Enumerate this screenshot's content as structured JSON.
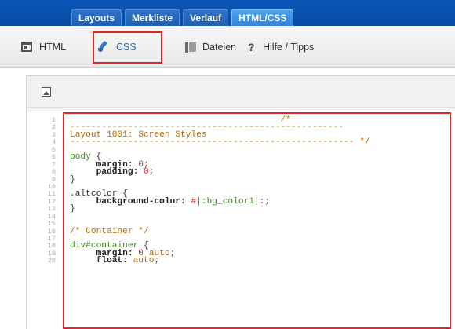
{
  "tabs": [
    {
      "label": "Layouts",
      "active": false
    },
    {
      "label": "Merkliste",
      "active": false
    },
    {
      "label": "Verlauf",
      "active": false
    },
    {
      "label": "HTML/CSS",
      "active": true
    }
  ],
  "toolbar": {
    "html_label": "HTML",
    "css_label": "CSS",
    "files_label": "Dateien",
    "help_label": "Hilfe / Tipps",
    "help_glyph": "?"
  },
  "colors": {
    "tabbar": "#0c56b8",
    "highlight_frame": "#e0262a",
    "comment": "#b26a00",
    "selector": "#3a8a1a",
    "value": "#d6302f"
  },
  "icons": {
    "html": "html-layout-icon",
    "css": "css-brush-icon",
    "files": "files-icon",
    "help": "help-icon",
    "image": "image-icon"
  },
  "editor": {
    "line_numbers": [
      "1",
      "2",
      "3",
      "4",
      "5",
      "6",
      "7",
      "8",
      "9",
      "10",
      "11",
      "12",
      "13",
      "14",
      "15",
      "16",
      "17",
      "18",
      "19",
      "20"
    ],
    "lines": [
      [
        {
          "t": "                                        /*",
          "c": "c-comment"
        }
      ],
      [
        {
          "t": "----------------------------------------------------",
          "c": "c-comment"
        }
      ],
      [
        {
          "t": "Layout 1001: Screen Styles",
          "c": "c-comment"
        }
      ],
      [
        {
          "t": "------------------------------------------------------ */",
          "c": "c-comment"
        }
      ],
      [
        {
          "t": "",
          "c": "c-plain"
        }
      ],
      [
        {
          "t": "body",
          "c": "c-sel"
        },
        {
          "t": " {",
          "c": "c-punc"
        }
      ],
      [
        {
          "t": "     margin:",
          "c": "c-prop"
        },
        {
          "t": " 0",
          "c": "c-num"
        },
        {
          "t": ";",
          "c": "c-punc"
        }
      ],
      [
        {
          "t": "     padding:",
          "c": "c-prop"
        },
        {
          "t": " 0",
          "c": "c-num"
        },
        {
          "t": ";",
          "c": "c-punc"
        }
      ],
      [
        {
          "t": "}",
          "c": "c-punc"
        }
      ],
      [
        {
          "t": "",
          "c": "c-plain"
        }
      ],
      [
        {
          "t": ".altcolor {",
          "c": "c-plain"
        }
      ],
      [
        {
          "t": "     background-color:",
          "c": "c-prop"
        },
        {
          "t": " #",
          "c": "c-num"
        },
        {
          "t": "|:bg_color1|",
          "c": "c-sel"
        },
        {
          "t": ":;",
          "c": "c-punc"
        }
      ],
      [
        {
          "t": "}",
          "c": "c-punc"
        }
      ],
      [
        {
          "t": "",
          "c": "c-plain"
        }
      ],
      [
        {
          "t": "",
          "c": "c-plain"
        }
      ],
      [
        {
          "t": "/* Container */",
          "c": "c-comment"
        }
      ],
      [
        {
          "t": "",
          "c": "c-plain"
        }
      ],
      [
        {
          "t": "div#container",
          "c": "c-sel"
        },
        {
          "t": " {",
          "c": "c-punc"
        }
      ],
      [
        {
          "t": "     margin:",
          "c": "c-prop"
        },
        {
          "t": " 0 ",
          "c": "c-num"
        },
        {
          "t": "auto",
          "c": "c-comment"
        },
        {
          "t": ";",
          "c": "c-punc"
        }
      ],
      [
        {
          "t": "     float: ",
          "c": "c-prop"
        },
        {
          "t": "auto",
          "c": "c-comment"
        },
        {
          "t": ";",
          "c": "c-punc"
        }
      ]
    ]
  }
}
